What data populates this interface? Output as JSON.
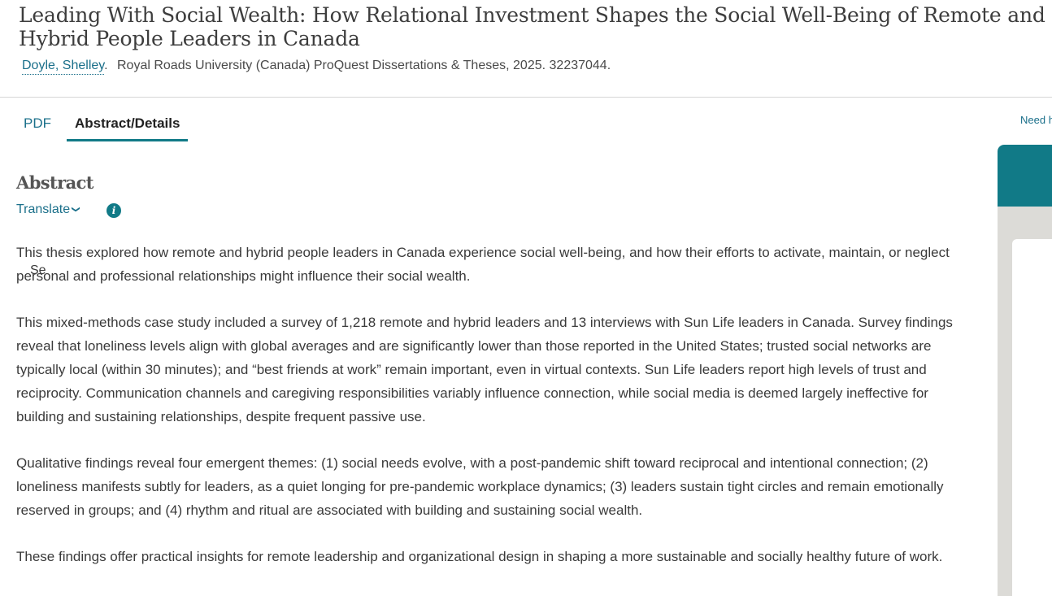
{
  "document": {
    "title": "Leading With Social Wealth: How Relational Investment Shapes the Social Well-Being of Remote and Hybrid People Leaders in Canada",
    "author": "Doyle, Shelley",
    "citation_rest": "Royal Roads University (Canada) ProQuest Dissertations & Theses,",
    "citation_id": "2025. 32237044."
  },
  "tabs": [
    {
      "label": "PDF",
      "active": false
    },
    {
      "label": "Abstract/Details",
      "active": true
    }
  ],
  "help_link": "Need h",
  "abstract": {
    "heading": "Abstract",
    "translate_label": "Translate",
    "translate_icon": "chevron-down-icon",
    "info_icon": "info-icon",
    "paragraphs": [
      "This thesis explored how remote and hybrid people leaders in Canada experience social well-being, and how their efforts to activate, maintain, or neglect personal and professional relationships might influence their social wealth.",
      "This mixed-methods case study included a survey of 1,218 remote and hybrid leaders and 13 interviews with Sun Life leaders in Canada. Survey findings reveal that loneliness levels align with global averages and are significantly lower than those reported in the United States; trusted social networks are typically local (within 30 minutes); and “best friends at work” remain important, even in virtual contexts. Sun Life leaders report high levels of trust and reciprocity. Communication channels and caregiving responsibilities variably influence connection, while social media is deemed largely ineffective for building and sustaining relationships, despite frequent passive use.",
      "Qualitative findings reveal four emergent themes: (1) social needs evolve, with a post-pandemic shift toward reciprocal and intentional connection; (2) loneliness manifests subtly for leaders, as a quiet longing for pre-pandemic workplace dynamics; (3) leaders sustain tight circles and remain emotionally reserved in groups; and (4) rhythm and ritual are associated with building and sustaining social wealth.",
      "These findings offer practical insights for remote leadership and organizational design in shaping a more sustainable and socially healthy future of work."
    ]
  },
  "side_panel": {
    "partial_text": "Se"
  },
  "colors": {
    "accent": "#117a87",
    "link": "#1a6f8a",
    "panel_bg": "#dcdbd7"
  }
}
